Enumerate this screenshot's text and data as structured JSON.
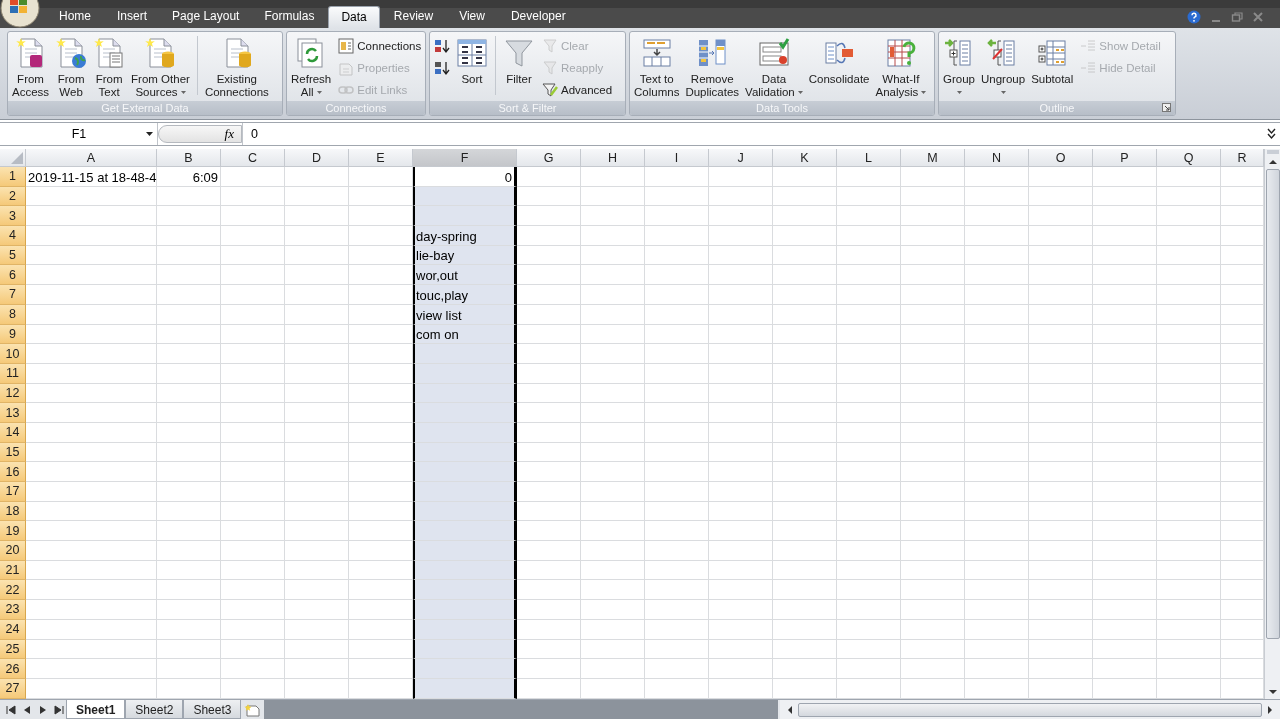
{
  "tabs": [
    {
      "label": "Home",
      "selected": false
    },
    {
      "label": "Insert",
      "selected": false
    },
    {
      "label": "Page Layout",
      "selected": false
    },
    {
      "label": "Formulas",
      "selected": false
    },
    {
      "label": "Data",
      "selected": true
    },
    {
      "label": "Review",
      "selected": false
    },
    {
      "label": "View",
      "selected": false
    },
    {
      "label": "Developer",
      "selected": false
    }
  ],
  "ribbon": [
    {
      "label": "Get External Data",
      "items": [
        {
          "kind": "large",
          "label": "From\nAccess",
          "disabled": false
        },
        {
          "kind": "large",
          "label": "From\nWeb",
          "disabled": false
        },
        {
          "kind": "large",
          "label": "From\nText",
          "disabled": false
        },
        {
          "kind": "large",
          "label": "From Other\nSources",
          "disabled": false,
          "dropdown": true
        },
        {
          "kind": "separator"
        },
        {
          "kind": "large",
          "label": "Existing\nConnections",
          "disabled": false
        }
      ]
    },
    {
      "label": "Connections",
      "items": [
        {
          "kind": "large",
          "label": "Refresh\nAll",
          "disabled": false,
          "dropdown": true
        },
        {
          "kind": "small",
          "label": "Connections",
          "disabled": false
        },
        {
          "kind": "small",
          "label": "Properties",
          "disabled": true
        },
        {
          "kind": "small",
          "label": "Edit Links",
          "disabled": true
        }
      ]
    },
    {
      "label": "Sort & Filter",
      "items": [
        {
          "kind": "icon",
          "disabled": false
        },
        {
          "kind": "icon",
          "disabled": false
        },
        {
          "kind": "large",
          "label": "Sort",
          "disabled": false
        },
        {
          "kind": "separator"
        },
        {
          "kind": "large",
          "label": "Filter",
          "disabled": false
        },
        {
          "kind": "small",
          "label": "Clear",
          "disabled": true
        },
        {
          "kind": "small",
          "label": "Reapply",
          "disabled": true
        },
        {
          "kind": "small",
          "label": "Advanced",
          "disabled": false
        }
      ]
    },
    {
      "label": "Data Tools",
      "items": [
        {
          "kind": "large",
          "label": "Text to\nColumns",
          "disabled": false
        },
        {
          "kind": "large",
          "label": "Remove\nDuplicates",
          "disabled": false
        },
        {
          "kind": "large",
          "label": "Data\nValidation",
          "disabled": false,
          "dropdown": true
        },
        {
          "kind": "large",
          "label": "Consolidate",
          "disabled": false
        },
        {
          "kind": "large",
          "label": "What-If\nAnalysis",
          "disabled": false,
          "dropdown": true
        }
      ]
    },
    {
      "label": "Outline",
      "launcher": true,
      "items": [
        {
          "kind": "large",
          "label": "Group",
          "disabled": false,
          "dropdown": true
        },
        {
          "kind": "large",
          "label": "Ungroup",
          "disabled": false,
          "dropdown": true
        },
        {
          "kind": "large",
          "label": "Subtotal",
          "disabled": false
        },
        {
          "kind": "small",
          "label": "Show Detail",
          "disabled": true
        },
        {
          "kind": "small",
          "label": "Hide Detail",
          "disabled": true
        }
      ]
    }
  ],
  "formula_bar": {
    "name_box": "F1",
    "function_label": "fx",
    "value": "0"
  },
  "columns": [
    {
      "label": "A",
      "selected": false
    },
    {
      "label": "B",
      "selected": false
    },
    {
      "label": "C",
      "selected": false
    },
    {
      "label": "D",
      "selected": false
    },
    {
      "label": "E",
      "selected": false
    },
    {
      "label": "F",
      "selected": true
    },
    {
      "label": "G",
      "selected": false
    },
    {
      "label": "H",
      "selected": false
    },
    {
      "label": "I",
      "selected": false
    },
    {
      "label": "J",
      "selected": false
    },
    {
      "label": "K",
      "selected": false
    },
    {
      "label": "L",
      "selected": false
    },
    {
      "label": "M",
      "selected": false
    },
    {
      "label": "N",
      "selected": false
    },
    {
      "label": "O",
      "selected": false
    },
    {
      "label": "P",
      "selected": false
    },
    {
      "label": "Q",
      "selected": false
    },
    {
      "label": "R",
      "selected": false
    }
  ],
  "rows": [
    {
      "label": "1",
      "selected": true,
      "cells": [
        {
          "text": "2019-11-15 at 18-48-4",
          "kind": "text"
        },
        {
          "text": "6:09",
          "kind": "number"
        },
        null,
        null,
        null,
        {
          "text": "0",
          "kind": "number",
          "active": true
        }
      ]
    },
    {
      "label": "2",
      "selected": true
    },
    {
      "label": "3",
      "selected": true
    },
    {
      "label": "4",
      "selected": true,
      "cells": [
        null,
        null,
        null,
        null,
        null,
        {
          "text": "day-spring",
          "kind": "text"
        }
      ]
    },
    {
      "label": "5",
      "selected": true,
      "cells": [
        null,
        null,
        null,
        null,
        null,
        {
          "text": "lie-bay",
          "kind": "text"
        }
      ]
    },
    {
      "label": "6",
      "selected": true,
      "cells": [
        null,
        null,
        null,
        null,
        null,
        {
          "text": "wor,out",
          "kind": "text"
        }
      ]
    },
    {
      "label": "7",
      "selected": true,
      "cells": [
        null,
        null,
        null,
        null,
        null,
        {
          "text": "touc,play",
          "kind": "text"
        }
      ]
    },
    {
      "label": "8",
      "selected": true,
      "cells": [
        null,
        null,
        null,
        null,
        null,
        {
          "text": "view list",
          "kind": "text"
        }
      ]
    },
    {
      "label": "9",
      "selected": true,
      "cells": [
        null,
        null,
        null,
        null,
        null,
        {
          "text": "com on",
          "kind": "text"
        }
      ]
    },
    {
      "label": "10",
      "selected": true
    },
    {
      "label": "11",
      "selected": true
    },
    {
      "label": "12",
      "selected": true
    },
    {
      "label": "13",
      "selected": true
    },
    {
      "label": "14",
      "selected": true
    },
    {
      "label": "15",
      "selected": true
    },
    {
      "label": "16",
      "selected": true
    },
    {
      "label": "17",
      "selected": true
    },
    {
      "label": "18",
      "selected": true
    },
    {
      "label": "19",
      "selected": true
    },
    {
      "label": "20",
      "selected": true
    },
    {
      "label": "21",
      "selected": true
    },
    {
      "label": "22",
      "selected": true
    },
    {
      "label": "23",
      "selected": true
    },
    {
      "label": "24",
      "selected": true
    },
    {
      "label": "25",
      "selected": true
    },
    {
      "label": "26",
      "selected": true
    },
    {
      "label": "27",
      "selected": true
    }
  ],
  "sheets": [
    {
      "label": "Sheet1",
      "selected": true
    },
    {
      "label": "Sheet2",
      "selected": false
    },
    {
      "label": "Sheet3",
      "selected": false
    }
  ]
}
